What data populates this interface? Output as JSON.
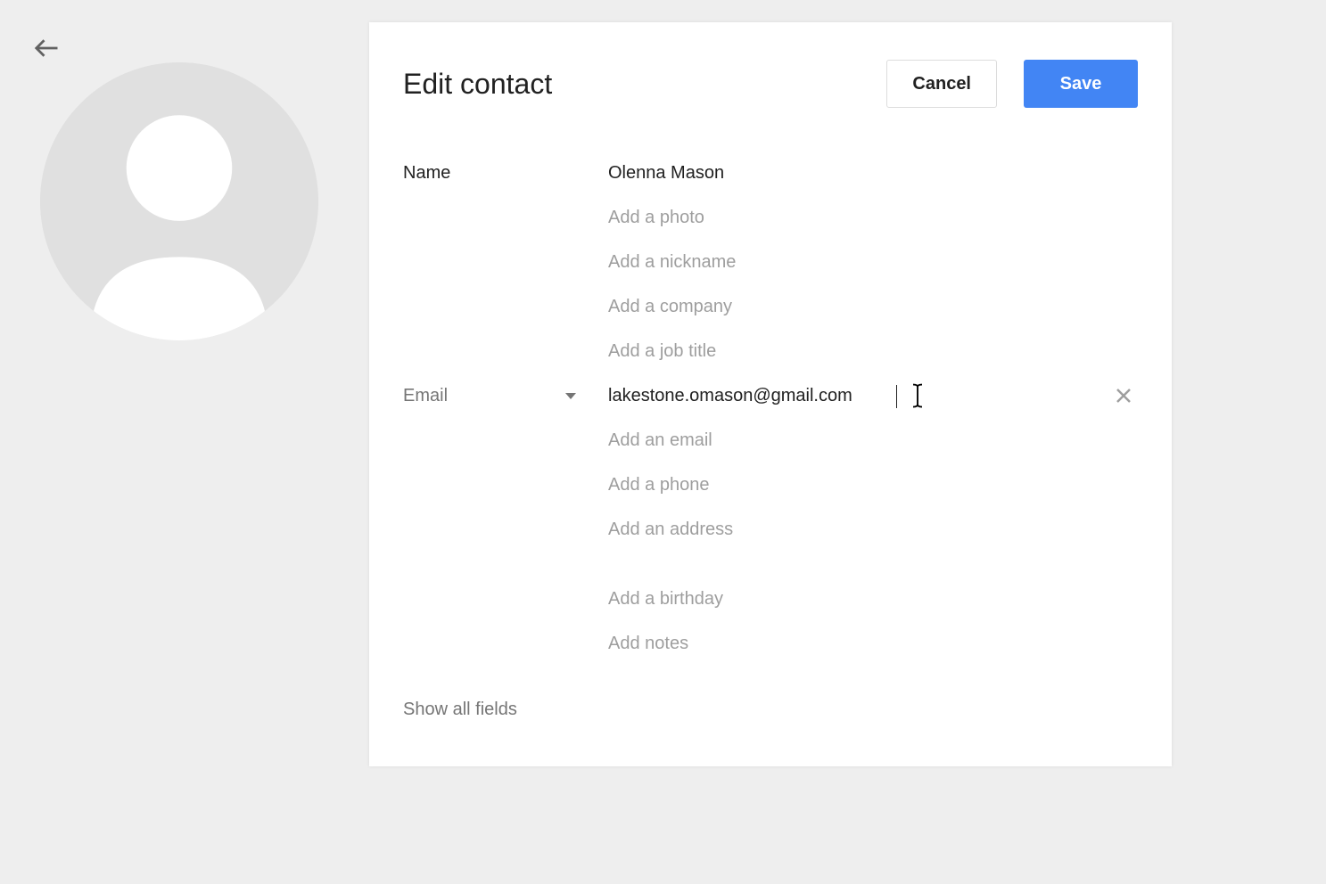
{
  "header": {
    "title": "Edit contact",
    "cancel_label": "Cancel",
    "save_label": "Save"
  },
  "labels": {
    "name": "Name",
    "email": "Email"
  },
  "fields": {
    "name_value": "Olenna Mason",
    "email_value": "lakestone.omason@gmail.com"
  },
  "placeholders": {
    "add_photo": "Add a photo",
    "add_nickname": "Add a nickname",
    "add_company": "Add a company",
    "add_job_title": "Add a job title",
    "add_email": "Add an email",
    "add_phone": "Add a phone",
    "add_address": "Add an address",
    "add_birthday": "Add a birthday",
    "add_notes": "Add notes"
  },
  "footer": {
    "show_all": "Show all fields"
  }
}
